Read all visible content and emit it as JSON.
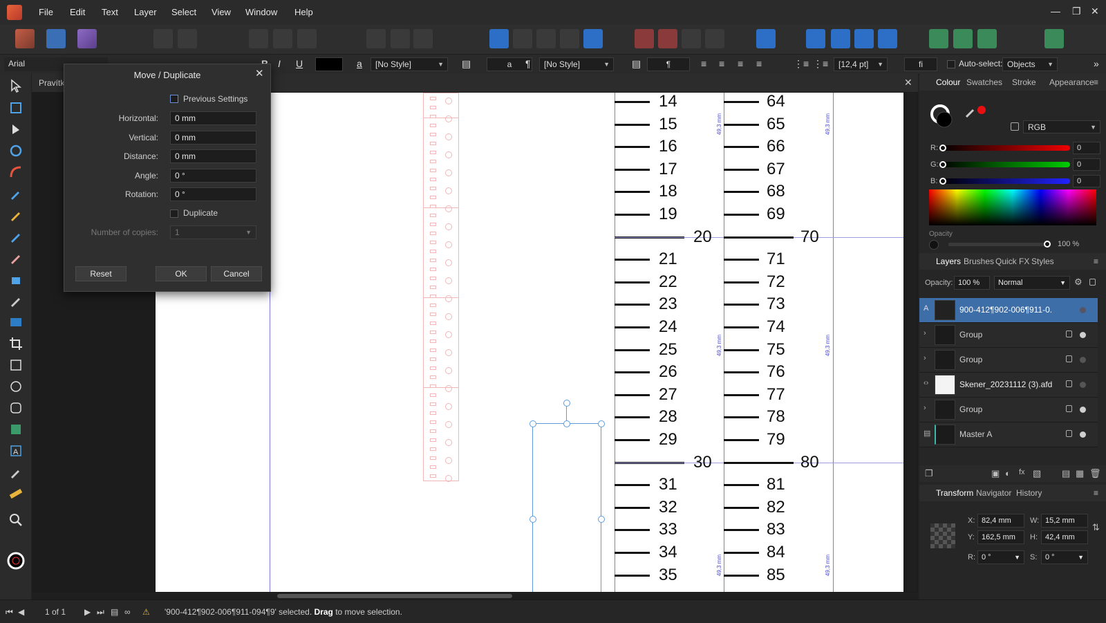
{
  "menu": [
    "File",
    "Edit",
    "Text",
    "Layer",
    "Select",
    "View",
    "Window",
    "Help"
  ],
  "context_bar": {
    "font_family": "Arial",
    "color_swatch": "#000000",
    "char_style": "[No Style]",
    "para_style": "[No Style]",
    "leading": "[12,4 pt]",
    "ligature_glyph": "fi",
    "auto_select_label": "Auto-select:",
    "auto_select_value": "Objects"
  },
  "doc_tab": "Pravítk",
  "dialog": {
    "title": "Move / Duplicate",
    "previous_settings": "Previous Settings",
    "horizontal_label": "Horizontal:",
    "horizontal_value": "0 mm",
    "vertical_label": "Vertical:",
    "vertical_value": "0 mm",
    "distance_label": "Distance:",
    "distance_value": "0 mm",
    "angle_label": "Angle:",
    "angle_value": "0 °",
    "rotation_label": "Rotation:",
    "rotation_value": "0 °",
    "duplicate_label": "Duplicate",
    "copies_label": "Number of copies:",
    "copies_value": "1",
    "reset": "Reset",
    "ok": "OK",
    "cancel": "Cancel"
  },
  "ruler": {
    "left_numbers": [
      "14",
      "15",
      "16",
      "17",
      "18",
      "19",
      "20",
      "21",
      "22",
      "23",
      "24",
      "25",
      "26",
      "27",
      "28",
      "29",
      "30",
      "31",
      "32",
      "33",
      "34",
      "35"
    ],
    "right_numbers": [
      "64",
      "65",
      "66",
      "67",
      "68",
      "69",
      "70",
      "71",
      "72",
      "73",
      "74",
      "75",
      "76",
      "77",
      "78",
      "79",
      "80",
      "81",
      "82",
      "83",
      "84",
      "85"
    ],
    "measure_label": "49,3 mm"
  },
  "colour_panel": {
    "tabs": [
      "Colour",
      "Swatches",
      "Stroke",
      "Appearance"
    ],
    "model": "RGB",
    "r_label": "R:",
    "r_value": "0",
    "g_label": "G:",
    "g_value": "0",
    "b_label": "B:",
    "b_value": "0",
    "opacity_label": "Opacity",
    "opacity_value": "100 %"
  },
  "layers_panel": {
    "tabs": [
      "Layers",
      "Brushes",
      "Quick FX",
      "Styles"
    ],
    "opacity_label": "Opacity:",
    "opacity_value": "100 %",
    "blend_mode": "Normal",
    "layers": [
      {
        "name": "900-412¶902-006¶911-0..."
      },
      {
        "name": "Group"
      },
      {
        "name": "Group"
      },
      {
        "name": "Skener_20231112 (3).afd..."
      },
      {
        "name": "Group"
      },
      {
        "name": "Master A"
      }
    ]
  },
  "transform_panel": {
    "tabs": [
      "Transform",
      "Navigator",
      "History"
    ],
    "x_label": "X:",
    "x_value": "82,4 mm",
    "w_label": "W:",
    "w_value": "15,2 mm",
    "y_label": "Y:",
    "y_value": "162,5 mm",
    "h_label": "H:",
    "h_value": "42,4 mm",
    "r_label": "R:",
    "r_value": "0 °",
    "s_label": "S:",
    "s_value": "0 °"
  },
  "status": {
    "page": "1 of 1",
    "message_prefix": "'900-412¶902-006¶911-094¶9' selected.",
    "message_bold": "Drag",
    "message_suffix": "to move selection."
  }
}
